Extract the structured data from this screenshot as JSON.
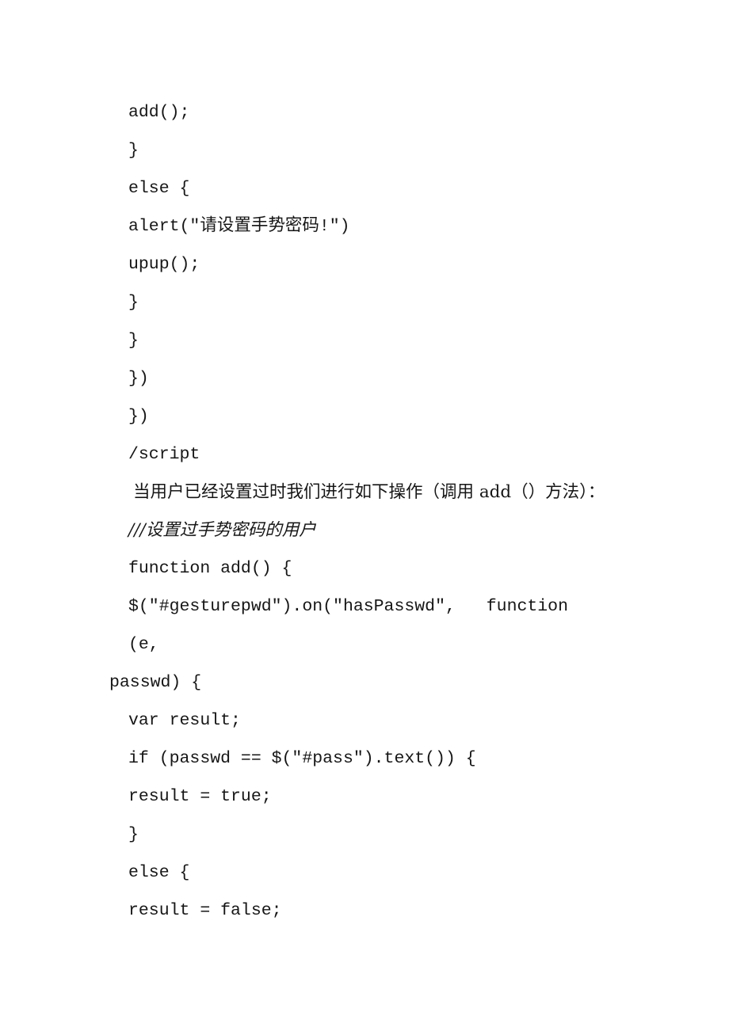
{
  "document": {
    "page_background": "#ffffff",
    "text_color": "#161616",
    "body_lines": [
      {
        "id": "l1",
        "kind": "code",
        "text": "add();"
      },
      {
        "id": "l2",
        "kind": "code",
        "text": "}"
      },
      {
        "id": "l3",
        "kind": "code",
        "text": "else {"
      },
      {
        "id": "l4",
        "kind": "code",
        "text": "alert(\"请设置手势密码!\")"
      },
      {
        "id": "l5",
        "kind": "code",
        "text": "upup();"
      },
      {
        "id": "l6",
        "kind": "code",
        "text": "}"
      },
      {
        "id": "l7",
        "kind": "code",
        "text": "}"
      },
      {
        "id": "l8",
        "kind": "code",
        "text": "})"
      },
      {
        "id": "l9",
        "kind": "code",
        "text": "})"
      },
      {
        "id": "l10",
        "kind": "code",
        "text": "/script"
      },
      {
        "id": "l11",
        "kind": "prose",
        "text": "当用户已经设置过时我们进行如下操作（调用 add（）方法）："
      },
      {
        "id": "l12",
        "kind": "prose-indent",
        "text": "///设置过手势密码的用户"
      },
      {
        "id": "l13",
        "kind": "code",
        "text": "function add() {"
      },
      {
        "id": "l14",
        "kind": "code-justified",
        "text": "$(\"#gesturepwd\").on(\"hasPasswd\", function (e,"
      },
      {
        "id": "l15",
        "kind": "code-wrap",
        "text": "passwd) {"
      },
      {
        "id": "l16",
        "kind": "code",
        "text": "var result;"
      },
      {
        "id": "l17",
        "kind": "code",
        "text": "if (passwd == $(\"#pass\").text()) {"
      },
      {
        "id": "l18",
        "kind": "code",
        "text": "result = true;"
      },
      {
        "id": "l19",
        "kind": "code",
        "text": "}"
      },
      {
        "id": "l20",
        "kind": "code",
        "text": "else {"
      },
      {
        "id": "l21",
        "kind": "code",
        "text": "result = false;"
      }
    ]
  }
}
